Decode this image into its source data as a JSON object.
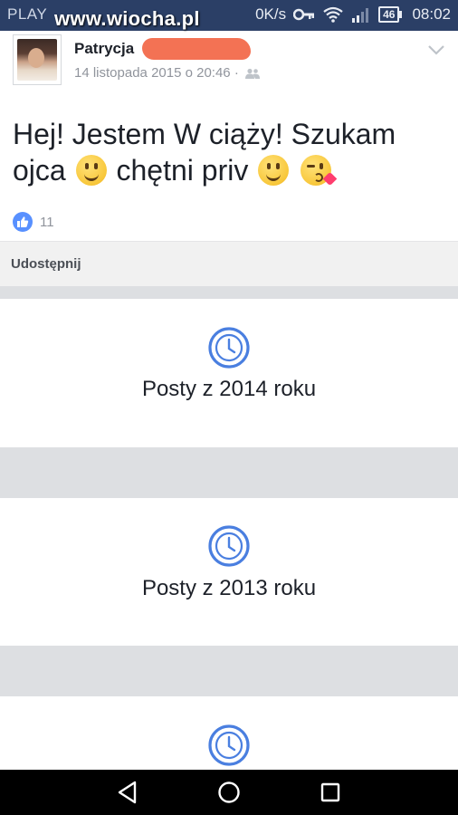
{
  "status_bar": {
    "carrier": "PLAY",
    "watermark": "www.wiocha.pl",
    "net_speed": "0K/s",
    "battery": "46",
    "time": "08:02"
  },
  "post": {
    "author": "Patrycja",
    "timestamp": "14 listopada 2015 o 20:46 ·",
    "message_line1": "Hej! Jestem W ciąży! Szukam",
    "message_line2_a": "ojca",
    "message_line2_b": "chętni priv",
    "like_count": "11",
    "share_label": "Udostępnij"
  },
  "year_cards": [
    {
      "label": "Posty z 2014 roku"
    },
    {
      "label": "Posty z 2013 roku"
    },
    {
      "label": ""
    }
  ],
  "colors": {
    "status_bar_bg": "#2b3f66",
    "accent_blue": "#5890ff",
    "clock_icon_blue": "#4a7fe0",
    "redaction": "#f26a4b",
    "divider_gray": "#dddfe2",
    "nav_bar_bg": "#000000"
  },
  "icons": [
    "key-icon",
    "wifi-icon",
    "signal-icon",
    "battery-icon",
    "audience-icon",
    "chevron-down-icon",
    "like-icon",
    "clock-icon",
    "back-icon",
    "home-icon",
    "recent-apps-icon"
  ]
}
